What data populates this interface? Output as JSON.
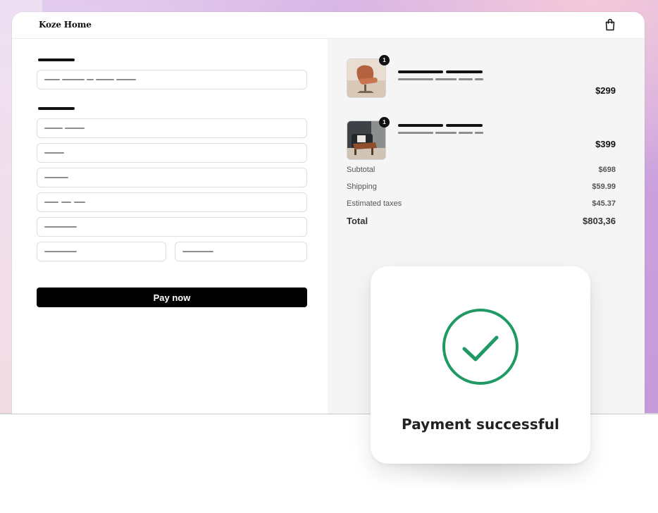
{
  "header": {
    "brand": "Koze Home",
    "cart_icon": "shopping-bag-icon"
  },
  "checkout_form": {
    "pay_button_label": "Pay now"
  },
  "order_summary": {
    "items": [
      {
        "quantity": "1",
        "price": "$299",
        "thumbnail": "armchair-image"
      },
      {
        "quantity": "1",
        "price": "$399",
        "thumbnail": "armchair-room-image"
      }
    ],
    "subtotal": {
      "label": "Subtotal",
      "value": "$698"
    },
    "shipping": {
      "label": "Shipping",
      "value": "$59.99"
    },
    "taxes": {
      "label": "Estimated taxes",
      "value": "$45.37"
    },
    "total": {
      "label": "Total",
      "value": "$803,36"
    }
  },
  "modal": {
    "icon": "check-circle-icon",
    "message": "Payment successful",
    "accent_color": "#1f9a64"
  }
}
